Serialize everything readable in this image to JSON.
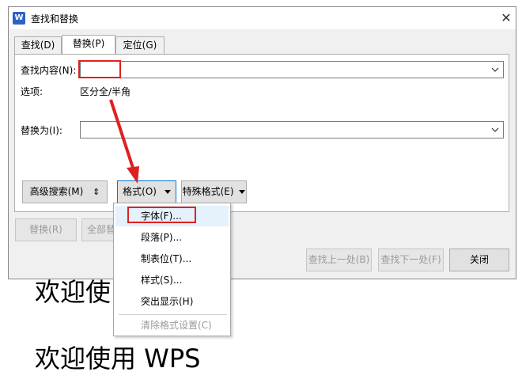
{
  "document": {
    "line1": "欢迎使",
    "line2": "欢迎使用 WPS"
  },
  "dialog": {
    "title": "查找和替换",
    "app_icon_glyph": "W",
    "close_glyph": "✕",
    "tabs": [
      {
        "label": "查找(D)",
        "active": false
      },
      {
        "label": "替换(P)",
        "active": true
      },
      {
        "label": "定位(G)",
        "active": false
      }
    ],
    "find_label": "查找内容(N):",
    "find_value": "",
    "options_label": "选项:",
    "options_value": "区分全/半角",
    "replace_label": "替换为(I):",
    "replace_value": "",
    "buttons": {
      "advanced": "高级搜索(M)",
      "advanced_glyph": "⇕",
      "format": "格式(O)",
      "special": "特殊格式(E)",
      "replace": "替换(R)",
      "replace_all": "全部替",
      "find_prev": "查找上一处(B)",
      "find_next": "查找下一处(F)",
      "close": "关闭"
    }
  },
  "format_menu": {
    "items": [
      {
        "label": "字体(F)...",
        "state": "hover"
      },
      {
        "label": "段落(P)...",
        "state": "normal"
      },
      {
        "label": "制表位(T)...",
        "state": "normal"
      },
      {
        "label": "样式(S)...",
        "state": "normal"
      },
      {
        "label": "突出显示(H)",
        "state": "normal"
      },
      {
        "label": "清除格式设置(C)",
        "state": "disabled"
      }
    ]
  },
  "colors": {
    "accent": "#0078d7",
    "highlight": "#e02020",
    "app_icon": "#2b62c8"
  }
}
